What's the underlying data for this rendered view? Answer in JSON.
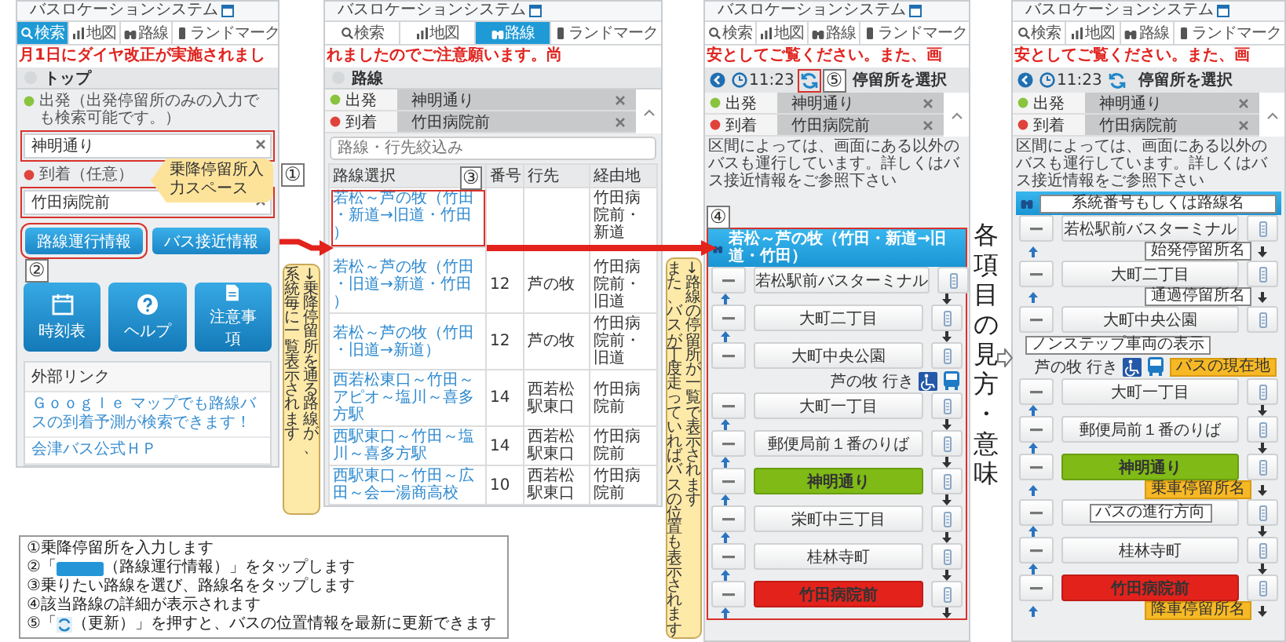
{
  "screens": [
    {
      "kind": "search",
      "app_title": "バスロケーションシステム",
      "tabs": [
        {
          "label": "検索",
          "selected": true
        },
        {
          "label": "地図",
          "selected": false
        },
        {
          "label": "路線",
          "selected": false
        },
        {
          "label": "ランドマーク",
          "selected": false
        }
      ],
      "ticker": "月1日にダイヤ改正が実施されまし",
      "breadcrumb": "トップ",
      "origin": {
        "label": "出発（出発停留所のみの入力でも検索可能です。）",
        "value": "神明通り"
      },
      "destination": {
        "label": "到着（任意）",
        "value": "竹田病院前"
      },
      "buttons": [
        "路線運行情報",
        "バス接近情報"
      ],
      "tiles": [
        "時刻表",
        "ヘルプ",
        "注意事項"
      ],
      "links_heading": "外部リンク",
      "links": [
        "Ｇｏｏｇｌｅ マップでも路線バスの到着予測が検索できます！",
        "会津バス公式ＨＰ"
      ]
    },
    {
      "kind": "routes",
      "app_title": "バスロケーションシステム",
      "tabs": [
        {
          "label": "検索",
          "selected": false
        },
        {
          "label": "地図",
          "selected": false
        },
        {
          "label": "路線",
          "selected": true
        },
        {
          "label": "ランドマーク",
          "selected": false
        }
      ],
      "ticker": "れましたのでご注意願います。尚",
      "breadcrumb": "路線",
      "origin": {
        "label": "出発",
        "value": "神明通り"
      },
      "destination": {
        "label": "到着",
        "value": "竹田病院前"
      },
      "filter_placeholder": "路線・行先絞込み",
      "columns": [
        "路線選択",
        "番号",
        "行先",
        "経由地"
      ],
      "rows": [
        {
          "route": "若松～芦の牧（竹田・新道→旧道・竹田）",
          "via": "竹田病院前・新道"
        },
        {
          "route": "若松～芦の牧（竹田・旧道→新道・竹田）",
          "number": "12",
          "destination": "芦の牧",
          "via": "竹田病院前・旧道"
        },
        {
          "route": "若松～芦の牧（竹田・旧道→新道）",
          "number": "12",
          "destination": "芦の牧",
          "via": "竹田病院前・旧道"
        },
        {
          "route": "西若松東口～竹田～アピオ～塩川～喜多方駅",
          "number": "14",
          "destination": "西若松駅東口",
          "via": "竹田病院前"
        },
        {
          "route": "西駅東口～竹田～塩川～喜多方駅",
          "number": "14",
          "destination": "西若松駅東口",
          "via": "竹田病院前"
        },
        {
          "route": "西駅東口～竹田～広田～会一湯商高校",
          "number": "10",
          "destination": "西若松駅東口",
          "via": "竹田病院前"
        }
      ]
    },
    {
      "kind": "route_detail",
      "app_title": "バスロケーションシステム",
      "tabs": [
        {
          "label": "検索",
          "selected": false
        },
        {
          "label": "地図",
          "selected": false
        },
        {
          "label": "路線",
          "selected": false
        },
        {
          "label": "ランドマーク",
          "selected": false
        }
      ],
      "ticker": "安としてご覧ください。また、画",
      "time": "11:23",
      "title": "停留所を選択",
      "origin": {
        "label": "出発",
        "value": "神明通り"
      },
      "destination": {
        "label": "到着",
        "value": "竹田病院前"
      },
      "notice": "区間によっては、画面にある以外のバスも運行しています。詳しくはバス接近情報をご参照下さい",
      "route": {
        "name": "若松～芦の牧（竹田・新道→旧道・竹田）"
      },
      "stops": [
        {
          "kind": "stop",
          "name": "若松駅前バスターミナル"
        },
        {
          "kind": "stop",
          "name": "大町二丁目"
        },
        {
          "kind": "stop",
          "name": "大町中央公園"
        },
        {
          "kind": "bus",
          "destination": "芦の牧 行き"
        },
        {
          "kind": "stop",
          "name": "大町一丁目"
        },
        {
          "kind": "stop",
          "name": "郵便局前１番のりば"
        },
        {
          "kind": "boarding",
          "name": "神明通り"
        },
        {
          "kind": "stop",
          "name": "栄町中三丁目"
        },
        {
          "kind": "stop",
          "name": "桂林寺町"
        },
        {
          "kind": "alighting",
          "name": "竹田病院前"
        }
      ]
    },
    {
      "kind": "route_detail",
      "app_title": "バスロケーションシステム",
      "tabs": [
        {
          "label": "検索",
          "selected": false
        },
        {
          "label": "地図",
          "selected": false
        },
        {
          "label": "路線",
          "selected": false
        },
        {
          "label": "ランドマーク",
          "selected": false
        }
      ],
      "ticker": "安としてご覧ください。また、画",
      "time": "11:23",
      "title": "停留所を選択",
      "origin": {
        "label": "出発",
        "value": "神明通り"
      },
      "destination": {
        "label": "到着",
        "value": "竹田病院前"
      },
      "notice": "区間によっては、画面にある以外のバスも運行しています。詳しくはバス接近情報をご参照下さい",
      "route": {
        "note": "系統番号もしくは路線名"
      },
      "stops": [
        {
          "kind": "stop",
          "name": "若松駅前バスターミナル",
          "note": "始発停留所名"
        },
        {
          "kind": "stop",
          "name": "大町二丁目",
          "note": "通過停留所名"
        },
        {
          "kind": "stop",
          "name": "大町中央公園"
        },
        {
          "kind": "bus",
          "destination": "芦の牧 行き",
          "notes": [
            "ノンステップ車両の表示",
            "バスの現在地"
          ]
        },
        {
          "kind": "stop",
          "name": "大町一丁目"
        },
        {
          "kind": "stop",
          "name": "郵便局前１番のりば"
        },
        {
          "kind": "boarding",
          "name": "神明通り",
          "note": "乗車停留所名"
        },
        {
          "kind": "stop",
          "note": "バスの進行方向"
        },
        {
          "kind": "stop",
          "name": "桂林寺町"
        },
        {
          "kind": "alighting",
          "name": "竹田病院前",
          "note": "降車停留所名"
        }
      ]
    }
  ],
  "callouts": [
    {
      "kind": "balloon",
      "lines": [
        "乗降停留所入力スペース"
      ]
    },
    {
      "kind": "vertical",
      "lines": [
        "系統毎に一覧表示されます",
        "↓乗降停留所を通る路線が、"
      ]
    },
    {
      "kind": "vertical",
      "lines": [
        "また、バスが丁度走っていればバスの位置も表示されます",
        "↓路線の停留所が一覧で表示されます"
      ]
    }
  ],
  "step_numbers": [
    "①",
    "②",
    "③",
    "④",
    "⑤"
  ],
  "side_title": "各項目の見方・意味",
  "steps": [
    {
      "kind": "text",
      "text": "①乗降停留所を入力します"
    },
    {
      "kind": "button",
      "before": "②「",
      "after": "（路線運行情報）」をタップします"
    },
    {
      "kind": "text",
      "text": "③乗りたい路線を選び、路線名をタップします"
    },
    {
      "kind": "text",
      "text": "④該当路線の詳細が表示されます"
    },
    {
      "kind": "refresh",
      "before": "⑤「",
      "after": "（更新）」を押すと、バスの位置情報を最新に更新できます"
    }
  ]
}
